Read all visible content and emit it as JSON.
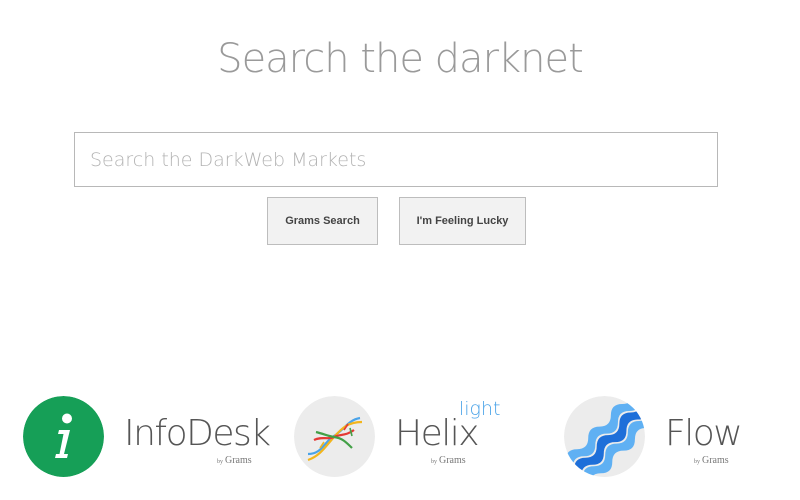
{
  "header": {
    "title": "Search the darknet"
  },
  "search": {
    "placeholder": "Search the DarkWeb Markets",
    "value": ""
  },
  "buttons": {
    "search_label": "Grams Search",
    "lucky_label": "I'm Feeling Lucky"
  },
  "apps": [
    {
      "name": "InfoDesk",
      "by": "by",
      "brand": "Grams",
      "icon": "info-icon",
      "color": "#169f57"
    },
    {
      "name": "Helix",
      "tag": "light",
      "by": "by",
      "brand": "Grams",
      "icon": "helix-icon",
      "color": "#4aa3e8"
    },
    {
      "name": "Flow",
      "by": "by",
      "brand": "Grams",
      "icon": "flow-icon",
      "color": "#1e88e5"
    }
  ]
}
